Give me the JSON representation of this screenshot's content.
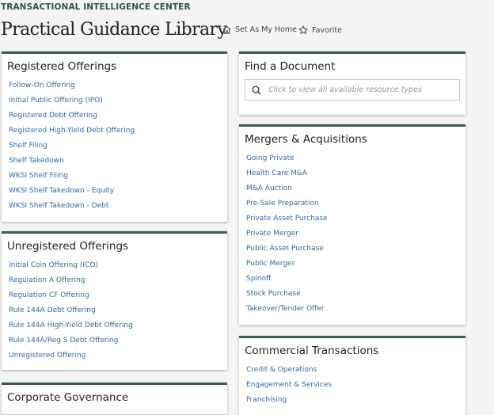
{
  "header": {
    "kicker": "TRANSACTIONAL INTELLIGENCE CENTER",
    "title": "Practical Guidance Library",
    "set_home": "Set As My Home",
    "favorite": "Favorite"
  },
  "registered": {
    "title": "Registered Offerings",
    "items": [
      "Follow-On Offering",
      "Initial Public Offering (IPO)",
      "Registered Debt Offering",
      "Registered High-Yield Debt Offering",
      "Shelf Filing",
      "Shelf Takedown",
      "WKSI Shelf Filing",
      "WKSI Shelf Takedown - Equity",
      "WKSI Shelf Takedown - Debt"
    ]
  },
  "unregistered": {
    "title": "Unregistered Offerings",
    "items": [
      "Initial Coin Offering (ICO)",
      "Regulation A Offering",
      "Regulation CF Offering",
      "Rule 144A Debt Offering",
      "Rule 144A High-Yield Debt Offering",
      "Rule 144A/Reg S Debt Offering",
      "Unregistered Offering"
    ]
  },
  "governance": {
    "title": "Corporate Governance"
  },
  "find": {
    "title": "Find a Document",
    "placeholder": "Click to view all available resource types"
  },
  "ma": {
    "title": "Mergers & Acquisitions",
    "items": [
      "Going Private",
      "Health Care M&A",
      "M&A Auction",
      "Pre-Sale Preparation",
      "Private Asset Purchase",
      "Private Merger",
      "Public Asset Purchase",
      "Public Merger",
      "Spinoff",
      "Stock Purchase",
      "Takeover/Tender Offer"
    ]
  },
  "commercial": {
    "title": "Commercial Transactions",
    "items": [
      "Credit & Operations",
      "Engagement & Services",
      "Franchising"
    ]
  }
}
